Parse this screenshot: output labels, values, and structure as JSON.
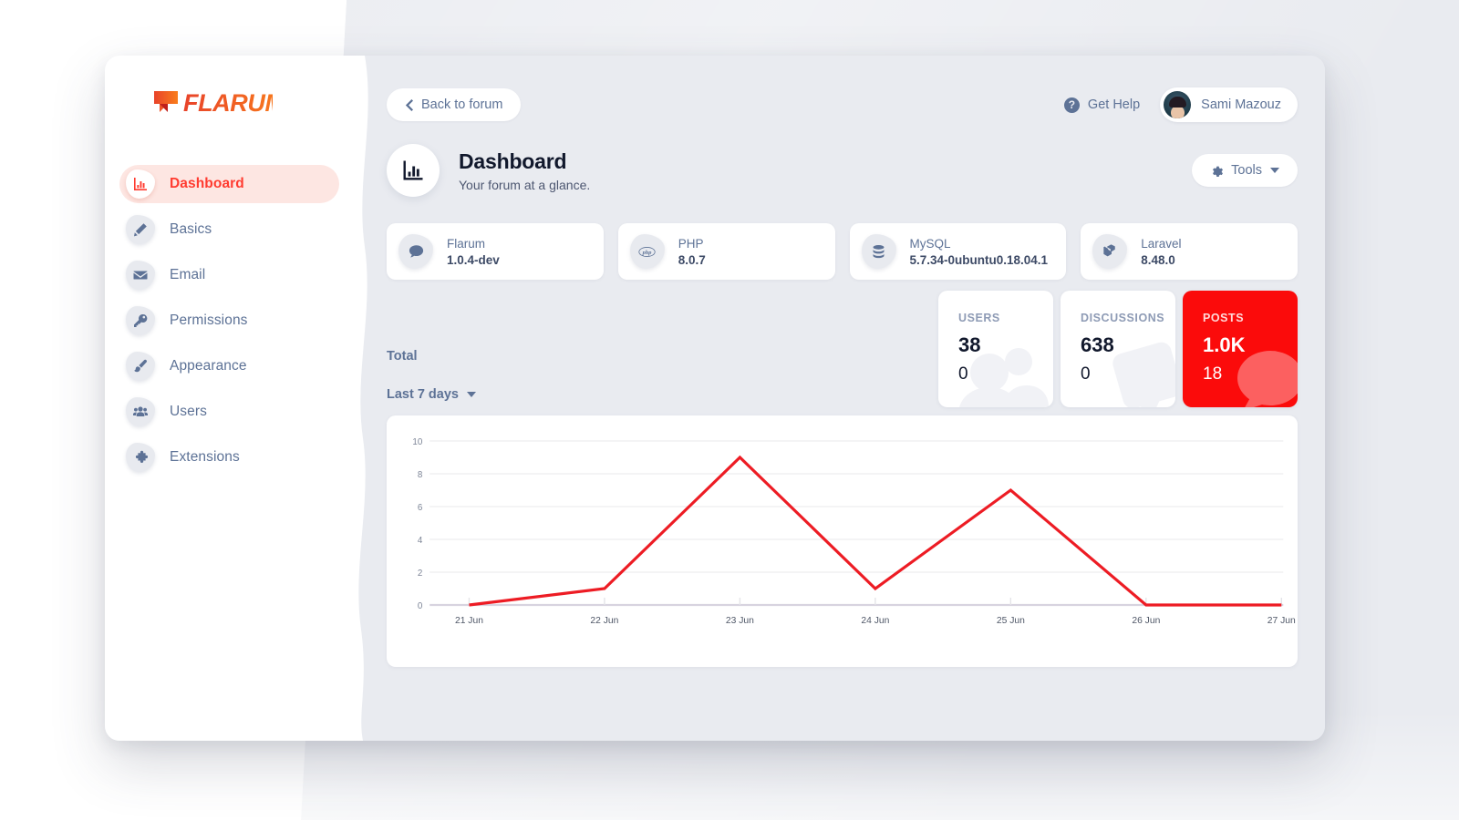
{
  "brand": {
    "name": "FLARUM",
    "logo_color": "#f04f23",
    "accent": "#fb0b0b"
  },
  "sidebar": {
    "items": [
      {
        "label": "Dashboard",
        "icon": "bar-chart-icon",
        "active": true
      },
      {
        "label": "Basics",
        "icon": "pencil-icon",
        "active": false
      },
      {
        "label": "Email",
        "icon": "envelope-icon",
        "active": false
      },
      {
        "label": "Permissions",
        "icon": "key-icon",
        "active": false
      },
      {
        "label": "Appearance",
        "icon": "paintbrush-icon",
        "active": false
      },
      {
        "label": "Users",
        "icon": "users-icon",
        "active": false
      },
      {
        "label": "Extensions",
        "icon": "puzzle-icon",
        "active": false
      }
    ]
  },
  "topbar": {
    "back_label": "Back to forum",
    "help_label": "Get Help",
    "help_glyph": "?",
    "user_name": "Sami Mazouz"
  },
  "page": {
    "title": "Dashboard",
    "subtitle": "Your forum at a glance.",
    "tools_label": "Tools"
  },
  "info_cards": [
    {
      "name": "Flarum",
      "version": "1.0.4-dev",
      "icon": "speech-bubble-icon"
    },
    {
      "name": "PHP",
      "version": "8.0.7",
      "icon": "php-icon"
    },
    {
      "name": "MySQL",
      "version": "5.7.34-0ubuntu0.18.04.1",
      "icon": "database-icon"
    },
    {
      "name": "Laravel",
      "version": "8.48.0",
      "icon": "laravel-icon"
    }
  ],
  "stats": [
    {
      "key": "USERS",
      "total": "38",
      "period": "0",
      "accent": false
    },
    {
      "key": "DISCUSSIONS",
      "total": "638",
      "period": "0",
      "accent": false
    },
    {
      "key": "POSTS",
      "total": "1.0K",
      "period": "18",
      "accent": true
    }
  ],
  "selectors": {
    "metric": "Total",
    "period": "Last 7 days"
  },
  "chart_data": {
    "type": "line",
    "title": "",
    "xlabel": "",
    "ylabel": "",
    "categories": [
      "21 Jun",
      "22 Jun",
      "23 Jun",
      "24 Jun",
      "25 Jun",
      "26 Jun",
      "27 Jun"
    ],
    "series": [
      {
        "name": "Total",
        "color": "#ed1c24",
        "values": [
          0,
          1,
          9,
          1,
          7,
          0,
          0
        ]
      }
    ],
    "ylim": [
      0,
      10
    ],
    "yticks": [
      0,
      2,
      4,
      6,
      8,
      10
    ],
    "grid": true,
    "legend": "none"
  }
}
